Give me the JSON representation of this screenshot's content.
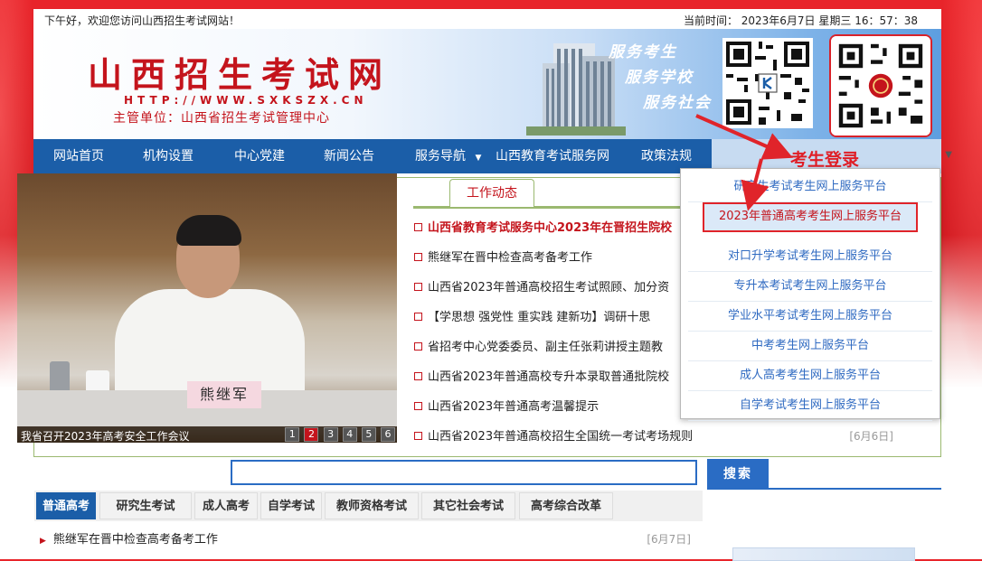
{
  "topbar": {
    "greeting": "下午好，欢迎您访问山西招生考试网站！",
    "clock": "当前时间： 2023年6月7日 星期三 16：57：38"
  },
  "banner": {
    "title": "山西招生考试网",
    "url": "HTTP://WWW.SXKSZX.CN",
    "dept": "主管单位：山西省招生考试管理中心",
    "slogans": [
      "服务考生",
      "服务学校",
      "服务社会"
    ]
  },
  "nav": {
    "items": [
      "网站首页",
      "机构设置",
      "中心党建",
      "新闻公告",
      "服务导航",
      "山西教育考试服务网",
      "政策法规"
    ],
    "login": "考生登录"
  },
  "slideshow": {
    "caption": "我省召开2023年高考安全工作会议",
    "nameplate": "熊继军",
    "pages": [
      "1",
      "2",
      "3",
      "4",
      "5",
      "6"
    ],
    "active_page": 2
  },
  "work_tab": "工作动态",
  "news": [
    "山西省教育考试服务中心2023年在晋招生院校",
    "熊继军在晋中检查高考备考工作",
    "山西省2023年普通高校招生考试照顾、加分资",
    "【学思想 强党性 重实践 建新功】调研十思",
    "省招考中心党委委员、副主任张莉讲授主题教",
    "山西省2023年普通高校专升本录取普通批院校",
    "山西省2023年普通高考温馨提示"
  ],
  "last_news": {
    "text": "山西省2023年普通高校招生全国统一考试考场规则",
    "date": "[6月6日]"
  },
  "dropdown": [
    "研究生考试考生网上服务平台",
    "2023年普通高考考生网上服务平台",
    "对口升学考试考生网上服务平台",
    "专升本考试考生网上服务平台",
    "学业水平考试考生网上服务平台",
    "中考考生网上服务平台",
    "成人高考考生网上服务平台",
    "自学考试考生网上服务平台"
  ],
  "search": {
    "value": "",
    "button": "搜索"
  },
  "bottom_tabs": [
    "普通高考",
    "研究生考试",
    "成人高考",
    "自学考试",
    "教师资格考试",
    "其它社会考试",
    "高考综合改革"
  ],
  "bottom_news": {
    "text": "熊继军在晋中检查高考备考工作",
    "date": "[6月7日]"
  },
  "colors": {
    "brand_red": "#c4141c",
    "nav_blue": "#1b5ea8",
    "border_green": "#9bb970",
    "highlight_red": "#e0242a"
  }
}
